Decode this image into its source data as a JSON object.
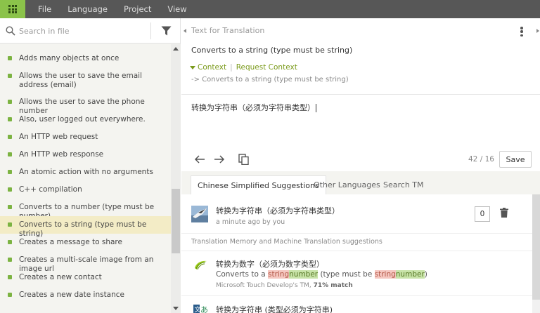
{
  "menu": {
    "items": [
      "File",
      "Language",
      "Project",
      "View"
    ]
  },
  "sidebar": {
    "search_placeholder": "Search in file",
    "items": [
      {
        "label": "Adds many objects at once",
        "active": false
      },
      {
        "label": "Allows the user to save the email address (email)",
        "active": false
      },
      {
        "label": "Allows the user to save the phone number",
        "active": false
      },
      {
        "label": "Also, user logged out everywhere.",
        "active": false
      },
      {
        "label": "An HTTP web request",
        "active": false
      },
      {
        "label": "An HTTP web response",
        "active": false
      },
      {
        "label": "An atomic action with no arguments",
        "active": false
      },
      {
        "label": "C++ compilation",
        "active": false
      },
      {
        "label": "Converts to a number (type must be number)",
        "active": false
      },
      {
        "label": "Converts to a string (type must be string)",
        "active": true
      },
      {
        "label": "Creates a message to share",
        "active": false
      },
      {
        "label": "Creates a multi-scale image from an image url",
        "active": false
      },
      {
        "label": "Creates a new contact",
        "active": false
      },
      {
        "label": "Creates a new date instance",
        "active": false
      }
    ]
  },
  "editor": {
    "header": "Text for Translation",
    "source_text": "Converts to a string (type must be string)",
    "context_label": "Context",
    "request_context_label": "Request Context",
    "context_detail": "-> Converts to a string (type must be string)",
    "translation": "转换为字符串（必须为字符串类型）",
    "counter": "42 / 16",
    "save_label": "Save"
  },
  "tabs": [
    "Chinese Simplified Suggestions",
    "Other Languages",
    "Search TM"
  ],
  "suggestion": {
    "text": "转换为字符串（必须为字符串类型）",
    "meta": "a minute ago by you",
    "votes": "0"
  },
  "tm": {
    "header": "Translation Memory and Machine Translation suggestions",
    "item1": {
      "text": "转换为数字（必须为数字类型）",
      "src_pre": "Converts to a ",
      "src_del1": "string",
      "src_ins1": "number",
      "src_mid": " (type must be ",
      "src_del2": "string",
      "src_ins2": "number",
      "src_post": ")",
      "meta_source": "Microsoft Touch Develop's TM, ",
      "meta_match": "71% match"
    },
    "item2": {
      "text": "转换为字符串 (类型必须为字符串)"
    }
  },
  "colors": {
    "topbar": "#575757",
    "accent": "#8bc34a",
    "item_dot": "#7cb342",
    "active_row": "#f3ecc6",
    "context_link": "#7a9a1a"
  }
}
